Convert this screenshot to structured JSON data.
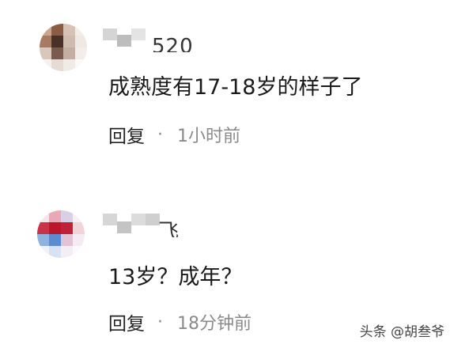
{
  "comments": [
    {
      "username_visible_tail": "520",
      "text": "成熟度有17-18岁的样子了",
      "reply_label": "回复",
      "separator": "·",
      "timestamp": "1小时前",
      "avatar_colors": [
        "#c9a692",
        "#8b5b44",
        "#d8c2b4",
        "#f3ece7",
        "#a87a62",
        "#4a3128",
        "#cfbcaf",
        "#efe8e3",
        "#d9c7bb",
        "#7a5a4c",
        "#c4ada1",
        "#f2ede9",
        "#f6f1ee",
        "#e6dbd5",
        "#f1ebe7",
        "#fbf8f6"
      ]
    },
    {
      "username_visible_tail": "飞",
      "text": "13岁？成年？",
      "reply_label": "回复",
      "separator": "·",
      "timestamp": "18分钟前",
      "avatar_colors": [
        "#f3e5ea",
        "#e8a8b6",
        "#d9cfe6",
        "#f6f0f4",
        "#c9334a",
        "#b8172c",
        "#c02038",
        "#f0d4da",
        "#8fb2e0",
        "#5b8bd1",
        "#e2c3d6",
        "#f4ecf2",
        "#eef3fb",
        "#d7e3f5",
        "#f3eef5",
        "#fbf9fb"
      ]
    }
  ],
  "watermark": "头条 @胡叁爷"
}
